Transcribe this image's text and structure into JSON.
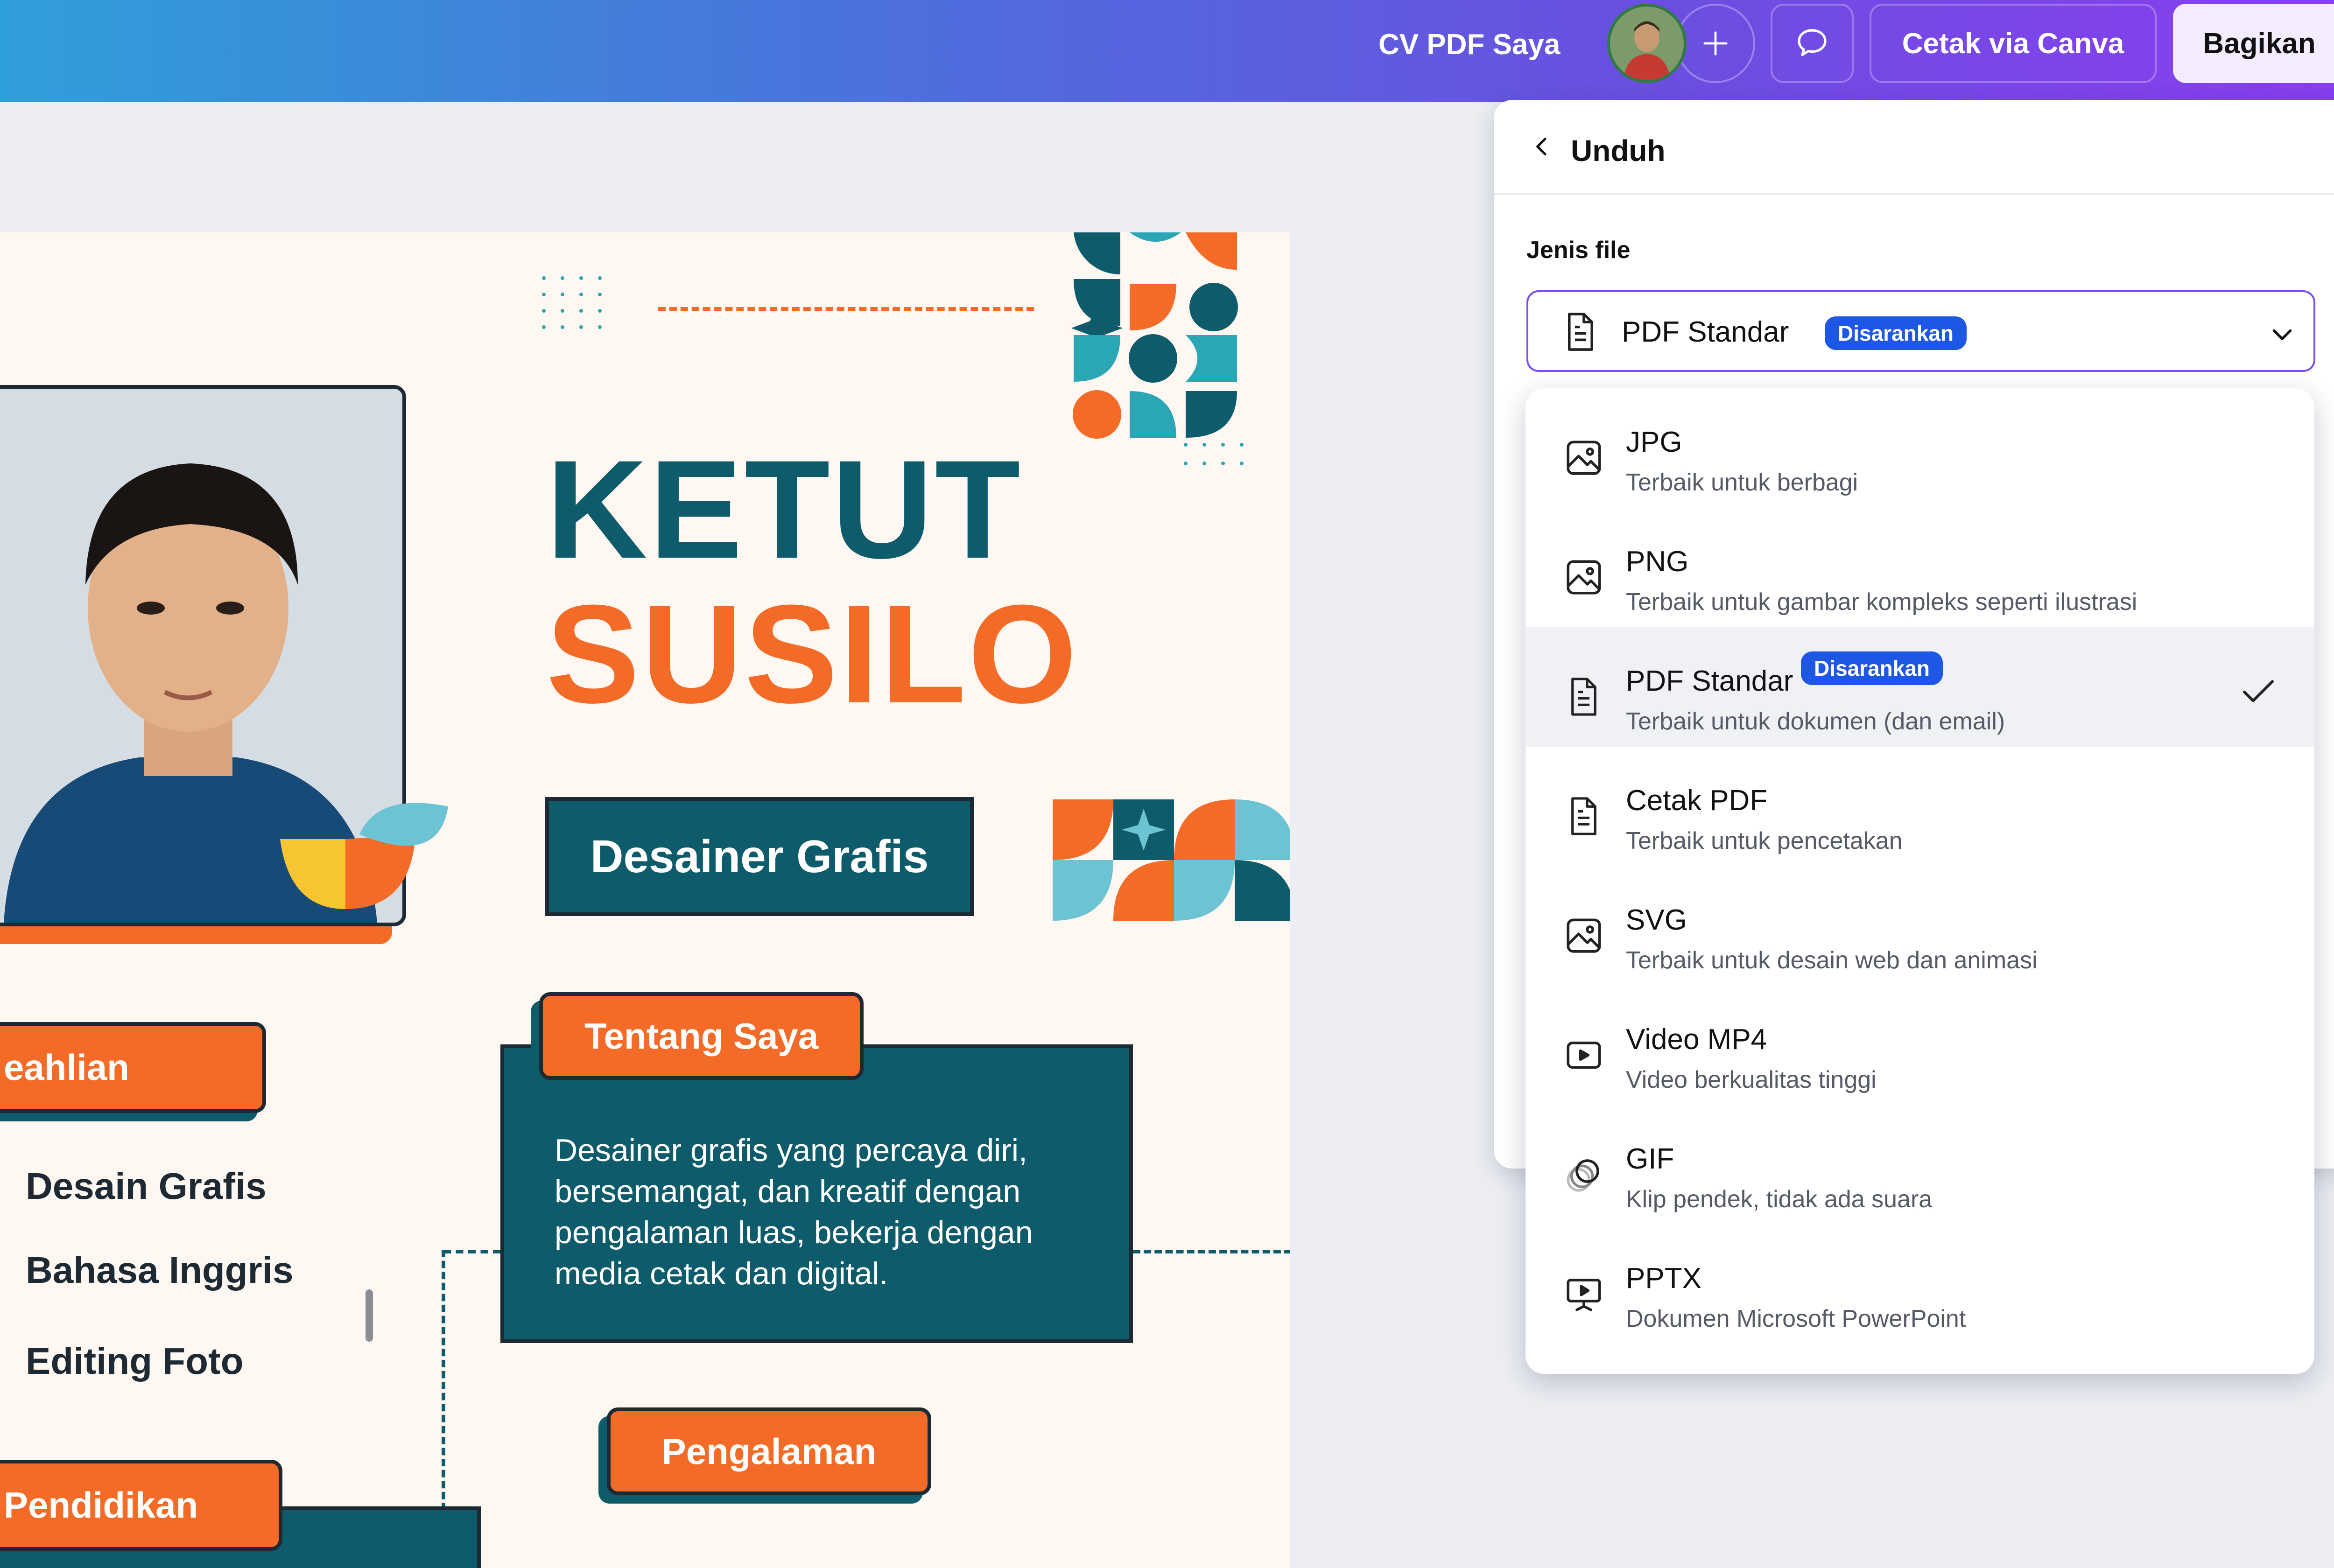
{
  "topbar": {
    "doc_title": "CV PDF Saya",
    "add_label": "+",
    "print_label": "Cetak via Canva",
    "share_label": "Bagikan"
  },
  "design": {
    "first_name": "KETUT",
    "last_name": "SUSILO",
    "role": "Desainer Grafis",
    "section_skills": "eahlian",
    "skills": [
      "Desain Grafis",
      "Bahasa Inggris",
      "Editing Foto"
    ],
    "section_about": "Tentang Saya",
    "about_text": "Desainer grafis yang percaya diri, bersemangat, dan kreatif dengan pengalaman luas, bekerja dengan media cetak dan digital.",
    "section_experience": "Pengalaman",
    "section_education": "Pendidikan",
    "colors": {
      "teal": "#0e5b6b",
      "orange": "#f36b27",
      "cream": "#fff8f2",
      "yellow": "#f7c531",
      "light_blue": "#6cc3d3"
    }
  },
  "download_panel": {
    "title": "Unduh",
    "file_type_label": "Jenis file",
    "selected_type": "PDF Standar",
    "selected_badge": "Disarankan",
    "accent_color": "#7a4ef0",
    "badge_color": "#1e57e3",
    "options": [
      {
        "name": "JPG",
        "desc": "Terbaik untuk berbagi",
        "icon": "image-icon"
      },
      {
        "name": "PNG",
        "desc": "Terbaik untuk gambar kompleks seperti ilustrasi",
        "icon": "image-icon"
      },
      {
        "name": "PDF Standar",
        "desc": "Terbaik untuk dokumen (dan email)",
        "icon": "document-icon",
        "badge": "Disarankan",
        "selected": true
      },
      {
        "name": "Cetak PDF",
        "desc": "Terbaik untuk pencetakan",
        "icon": "document-icon"
      },
      {
        "name": "SVG",
        "desc": "Terbaik untuk desain web dan animasi",
        "icon": "image-icon"
      },
      {
        "name": "Video MP4",
        "desc": "Video berkualitas tinggi",
        "icon": "video-icon"
      },
      {
        "name": "GIF",
        "desc": "Klip pendek, tidak ada suara",
        "icon": "gif-icon"
      },
      {
        "name": "PPTX",
        "desc": "Dokumen Microsoft PowerPoint",
        "icon": "presentation-icon"
      }
    ]
  }
}
